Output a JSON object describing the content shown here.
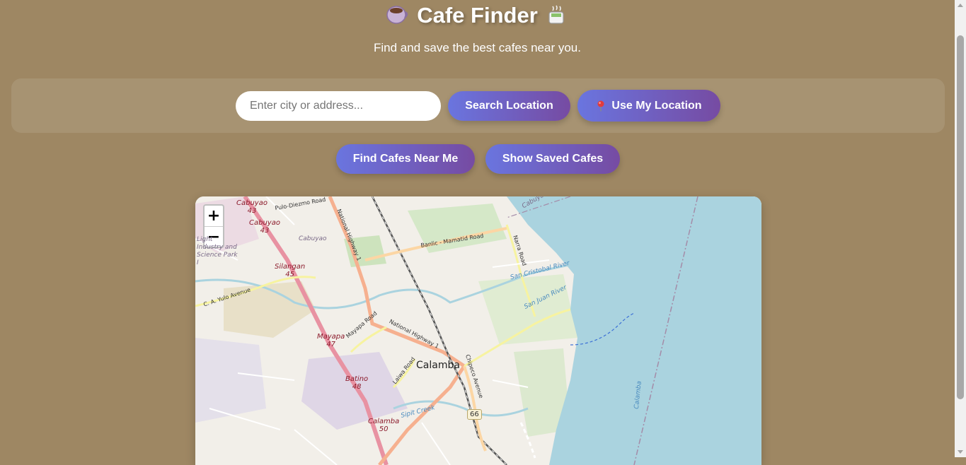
{
  "header": {
    "title": "Cafe Finder",
    "title_icon_left": "coffee-cup-icon",
    "title_icon_right": "hot-beverage-icon",
    "subtitle": "Find and save the best cafes near you."
  },
  "search": {
    "placeholder": "Enter city or address...",
    "value": "",
    "search_label": "Search Location",
    "locate_label": "Use My Location",
    "locate_icon": "pin-icon"
  },
  "actions": {
    "find_label": "Find Cafes Near Me",
    "saved_label": "Show Saved Cafes"
  },
  "map": {
    "zoom_in": "+",
    "zoom_out": "−",
    "city": "Calamba",
    "places": [
      {
        "name": "Cabuyao",
        "number": "43"
      },
      {
        "name": "Cabuyao",
        "number": "43"
      },
      {
        "name": "Silangan",
        "number": "45"
      },
      {
        "name": "Mayapa",
        "number": "47"
      },
      {
        "name": "Batino",
        "number": "48"
      },
      {
        "name": "Calamba",
        "number": "50"
      }
    ],
    "roads": {
      "pulo_diezmo": "Pulo-Diezmo Road",
      "national_highway": "National Highway 1",
      "national_highway_2": "National Highway 1",
      "banlic": "Banlic - Mamatid Road",
      "narra": "Narra Road",
      "ca_yulo": "C. A. Yulo Avenue",
      "mayapa_road": "Mayapa Road",
      "laiwa": "Laiwa Road",
      "chipeco": "Chipeco Avenue"
    },
    "waters": {
      "san_cristobal": "San Cristobal River",
      "san_juan": "San Juan River",
      "sipit": "Sipit Creek",
      "lake_label": "Calamba"
    },
    "admin": {
      "cabuyao": "Cabuyao",
      "cabuyao_top": "Cabuyao",
      "light_industry": "Light Industry and Science Park I"
    },
    "shield": "66"
  },
  "colors": {
    "background": "#9e8763",
    "button_gradient_start": "#6a75df",
    "button_gradient_end": "#764ba2",
    "water": "#aad3df",
    "primary_road": "#e892a2",
    "secondary_road": "#fcd6a4"
  }
}
